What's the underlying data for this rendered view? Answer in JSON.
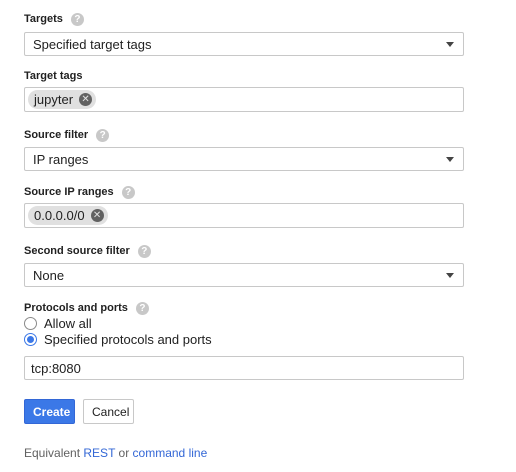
{
  "targets": {
    "label": "Targets",
    "value": "Specified target tags"
  },
  "target_tags": {
    "label": "Target tags",
    "tags": [
      "jupyter"
    ]
  },
  "source_filter": {
    "label": "Source filter",
    "value": "IP ranges"
  },
  "source_ip_ranges": {
    "label": "Source IP ranges",
    "ranges": [
      "0.0.0.0/0"
    ]
  },
  "second_source_filter": {
    "label": "Second source filter",
    "value": "None"
  },
  "protocols": {
    "label": "Protocols and ports",
    "option_all": "Allow all",
    "option_specified": "Specified protocols and ports",
    "selected": "specified",
    "value": "tcp:8080"
  },
  "buttons": {
    "create": "Create",
    "cancel": "Cancel"
  },
  "footer": {
    "prefix": "Equivalent",
    "rest_link": "REST",
    "or": "or",
    "cli_link": "command line"
  },
  "help_icon_glyph": "?",
  "remove_icon_glyph": "✕",
  "colors": {
    "accent": "#3b78e7",
    "link": "#3367d6"
  }
}
